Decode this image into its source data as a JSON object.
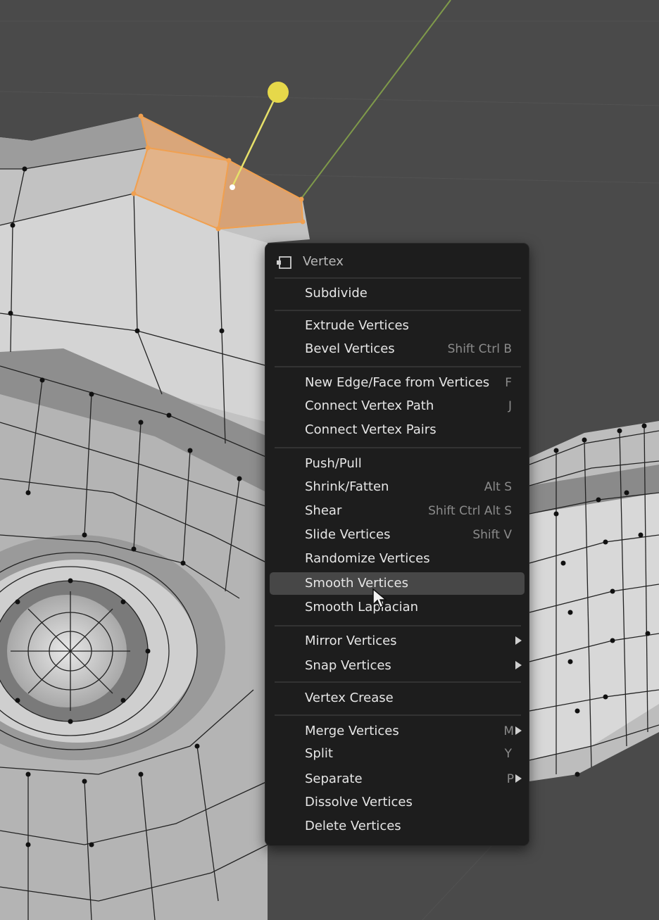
{
  "menu": {
    "title": "Vertex",
    "title_icon": "vertex-select-icon",
    "items": [
      {
        "label": "Subdivide",
        "shortcut": ""
      },
      {
        "label": "Extrude Vertices",
        "shortcut": ""
      },
      {
        "label": "Bevel Vertices",
        "shortcut": "Shift Ctrl B"
      },
      {
        "label": "New Edge/Face from Vertices",
        "shortcut": "F"
      },
      {
        "label": "Connect Vertex Path",
        "shortcut": "J"
      },
      {
        "label": "Connect Vertex Pairs",
        "shortcut": ""
      },
      {
        "label": "Push/Pull",
        "shortcut": ""
      },
      {
        "label": "Shrink/Fatten",
        "shortcut": "Alt S"
      },
      {
        "label": "Shear",
        "shortcut": "Shift Ctrl Alt S"
      },
      {
        "label": "Slide Vertices",
        "shortcut": "Shift V"
      },
      {
        "label": "Randomize Vertices",
        "shortcut": ""
      },
      {
        "label": "Smooth Vertices",
        "shortcut": "",
        "highlighted": true
      },
      {
        "label": "Smooth Laplacian",
        "shortcut": ""
      },
      {
        "label": "Mirror Vertices",
        "shortcut": "",
        "submenu": true
      },
      {
        "label": "Snap Vertices",
        "shortcut": "",
        "submenu": true
      },
      {
        "label": "Vertex Crease",
        "shortcut": ""
      },
      {
        "label": "Merge Vertices",
        "shortcut": "M",
        "submenu": true
      },
      {
        "label": "Split",
        "shortcut": "Y"
      },
      {
        "label": "Separate",
        "shortcut": "P",
        "submenu": true
      },
      {
        "label": "Dissolve Vertices",
        "shortcut": ""
      },
      {
        "label": "Delete Vertices",
        "shortcut": ""
      }
    ]
  },
  "colors": {
    "viewport_bg": "#4a4a4a",
    "menu_bg": "#1d1d1d",
    "highlight": "#474747",
    "selection": "#f0a050",
    "gizmo": "#e6e06a"
  }
}
